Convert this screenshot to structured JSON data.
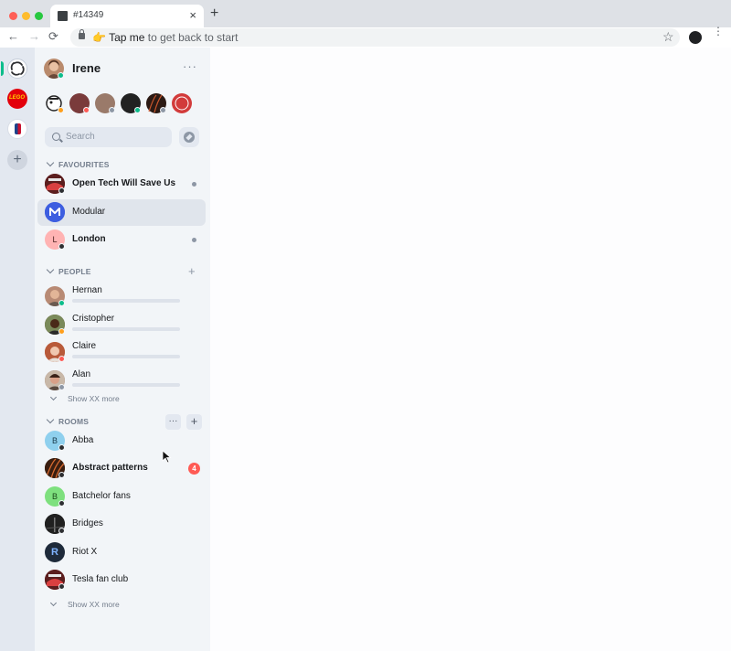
{
  "browser": {
    "tab_title": "#14349",
    "tab_close": "×",
    "new_tab": "+",
    "back": "←",
    "forward": "→",
    "reload": "⟳",
    "omnibox_emoji": "👉",
    "omnibox_bold": "Tap me",
    "omnibox_rest": " to get back to start",
    "star": "☆",
    "menu": "⋮"
  },
  "spaces": {
    "lego_text": "LEGO",
    "add": "+"
  },
  "user": {
    "name": "Irene",
    "menu": "···"
  },
  "search": {
    "placeholder": "Search"
  },
  "favourites": {
    "header": "FAVOURITES",
    "rooms": [
      {
        "name": "Open Tech Will Save Us",
        "bold": true,
        "unread_dot": true
      },
      {
        "name": "Modular",
        "bold": false,
        "selected": true
      },
      {
        "name": "London",
        "letter": "L",
        "bold": true,
        "unread_dot": true
      }
    ]
  },
  "people": {
    "header": "PEOPLE",
    "add": "+",
    "items": [
      {
        "name": "Hernan",
        "status": "online"
      },
      {
        "name": "Cristopher",
        "status": "away"
      },
      {
        "name": "Claire",
        "status": "busy"
      },
      {
        "name": "Alan",
        "status": "offline"
      }
    ],
    "show_more": "Show XX more"
  },
  "rooms": {
    "header": "ROOMS",
    "options": "···",
    "add": "+",
    "items": [
      {
        "name": "Abba",
        "letter": "B"
      },
      {
        "name": "Abstract patterns",
        "bold": true,
        "badge": "4"
      },
      {
        "name": "Batchelor fans",
        "letter": "B"
      },
      {
        "name": "Bridges"
      },
      {
        "name": "Riot X",
        "letter": "R"
      },
      {
        "name": "Tesla fan club"
      }
    ],
    "show_more": "Show XX more"
  },
  "colors": {
    "accent": "#0dbd8b",
    "online": "#0dbd8b",
    "away": "#ff9f1c",
    "busy": "#ff5b55",
    "offline": "#8d97a5",
    "badge": "#ff5b55"
  }
}
